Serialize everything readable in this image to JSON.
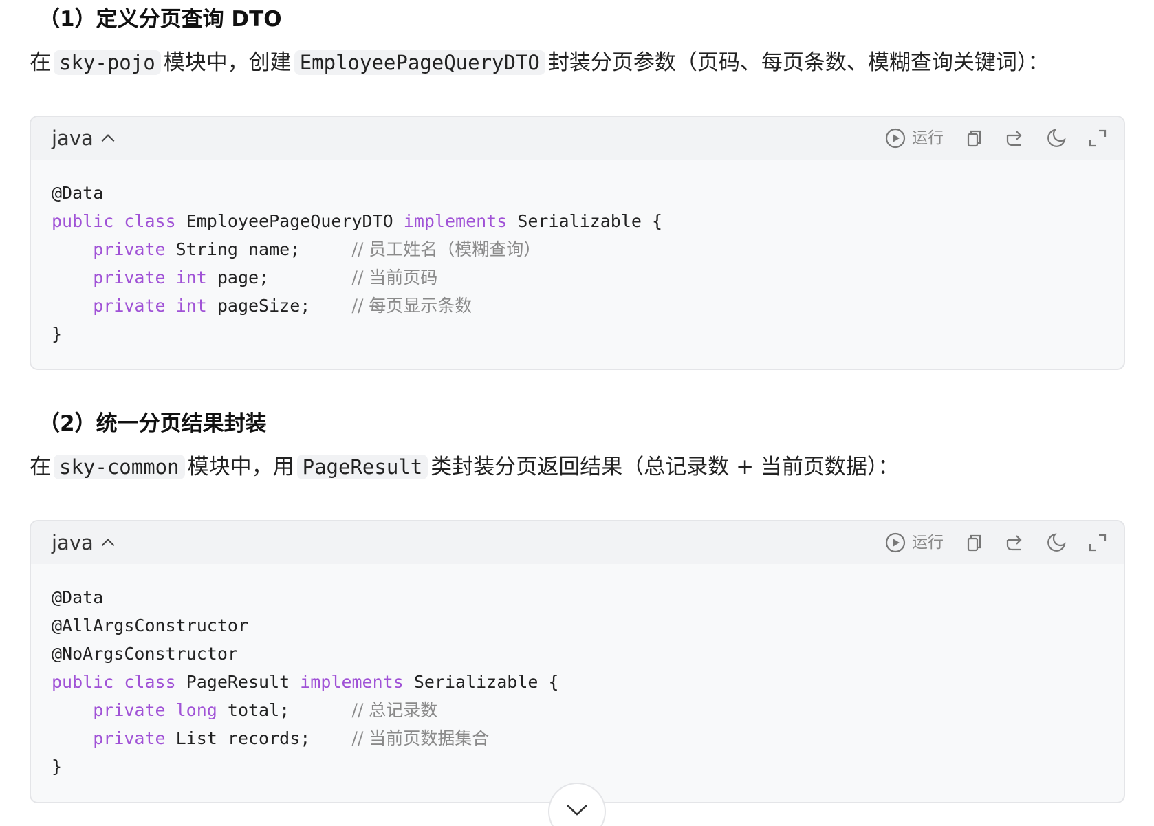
{
  "section1": {
    "heading": "（1）定义分页查询 DTO",
    "para": {
      "t1": "在",
      "c1": "sky-pojo",
      "t2": "模块中，创建",
      "c2": "EmployeePageQueryDTO",
      "t3": "封装分页参数（页码、每页条数、模糊查询关键词）："
    },
    "block": {
      "lang": "java",
      "run_label": "运行",
      "lines": [
        [
          {
            "t": "@Data",
            "c": ""
          }
        ],
        [
          {
            "t": "public class",
            "c": "kw"
          },
          {
            "t": " EmployeePageQueryDTO ",
            "c": ""
          },
          {
            "t": "implements",
            "c": "kw"
          },
          {
            "t": " Serializable {",
            "c": ""
          }
        ],
        [
          {
            "t": "    ",
            "c": ""
          },
          {
            "t": "private",
            "c": "kw"
          },
          {
            "t": " String name;     ",
            "c": ""
          },
          {
            "t": "// 员工姓名（模糊查询）",
            "c": "cm"
          }
        ],
        [
          {
            "t": "    ",
            "c": ""
          },
          {
            "t": "private int",
            "c": "kw"
          },
          {
            "t": " page;        ",
            "c": ""
          },
          {
            "t": "// 当前页码",
            "c": "cm"
          }
        ],
        [
          {
            "t": "    ",
            "c": ""
          },
          {
            "t": "private int",
            "c": "kw"
          },
          {
            "t": " pageSize;    ",
            "c": ""
          },
          {
            "t": "// 每页显示条数",
            "c": "cm"
          }
        ],
        [
          {
            "t": "}",
            "c": ""
          }
        ]
      ]
    }
  },
  "section2": {
    "heading": "（2）统一分页结果封装",
    "para": {
      "t1": "在",
      "c1": "sky-common",
      "t2": "模块中，用",
      "c2": "PageResult",
      "t3": "类封装分页返回结果（总记录数 + 当前页数据）："
    },
    "block": {
      "lang": "java",
      "run_label": "运行",
      "lines": [
        [
          {
            "t": "@Data",
            "c": ""
          }
        ],
        [
          {
            "t": "@AllArgsConstructor",
            "c": ""
          }
        ],
        [
          {
            "t": "@NoArgsConstructor",
            "c": ""
          }
        ],
        [
          {
            "t": "public class",
            "c": "kw"
          },
          {
            "t": " PageResult ",
            "c": ""
          },
          {
            "t": "implements",
            "c": "kw"
          },
          {
            "t": " Serializable {",
            "c": ""
          }
        ],
        [
          {
            "t": "    ",
            "c": ""
          },
          {
            "t": "private long",
            "c": "kw"
          },
          {
            "t": " total;      ",
            "c": ""
          },
          {
            "t": "// 总记录数",
            "c": "cm"
          }
        ],
        [
          {
            "t": "    ",
            "c": ""
          },
          {
            "t": "private",
            "c": "kw"
          },
          {
            "t": " List records;    ",
            "c": ""
          },
          {
            "t": "// 当前页数据集合",
            "c": "cm"
          }
        ],
        [
          {
            "t": "}",
            "c": ""
          }
        ]
      ]
    }
  },
  "icons": [
    "chevron-up-icon",
    "play-circle-icon",
    "copy-icon",
    "share-icon",
    "theme-moon-icon",
    "fullscreen-icon",
    "chevron-down-icon"
  ],
  "colors": {
    "keyword": "#a052d6",
    "comment": "#8a8a8a",
    "code_bg": "#f8f9fa",
    "header_bg": "#f2f3f5"
  }
}
